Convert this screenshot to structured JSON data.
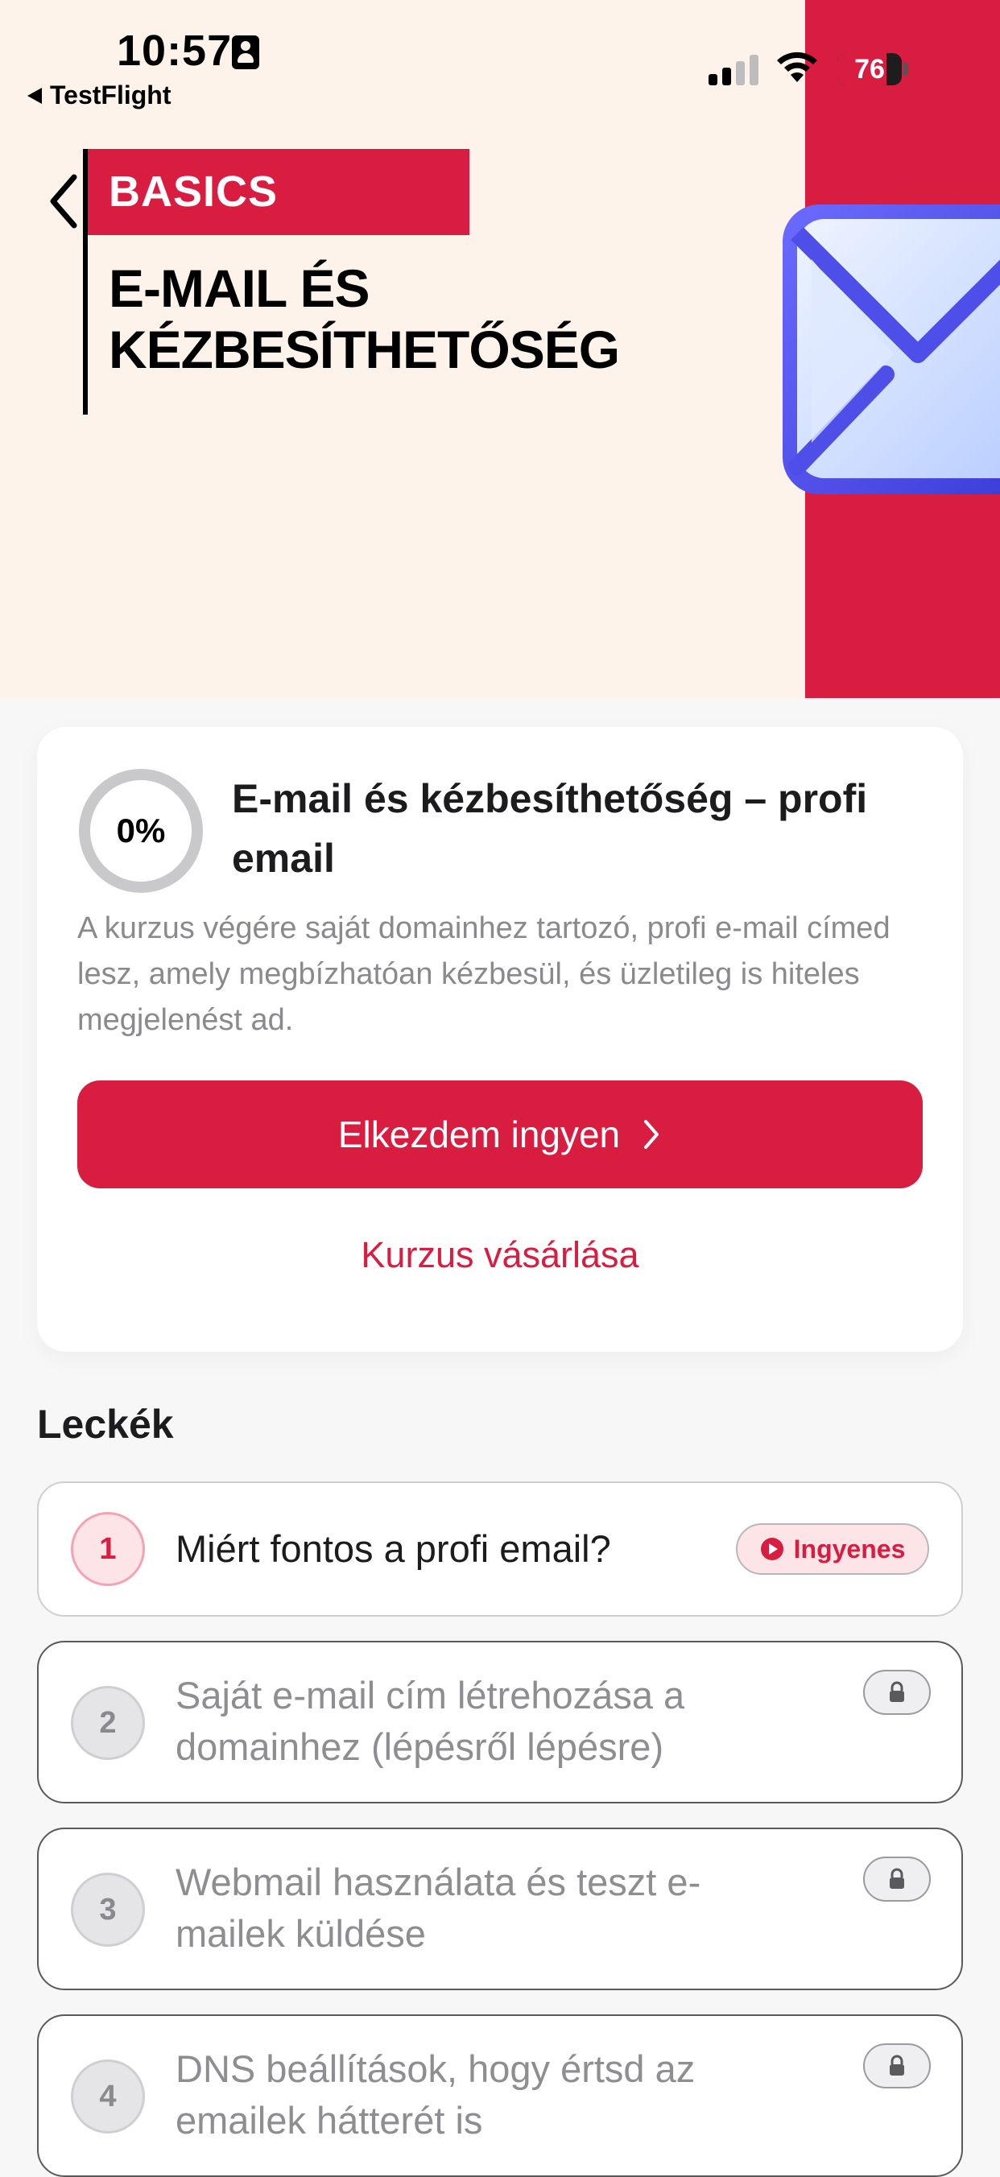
{
  "status_bar": {
    "time": "10:57",
    "back_app": "TestFlight",
    "battery": "76"
  },
  "hero": {
    "badge": "BASICS",
    "title_line1": "E-MAIL ÉS",
    "title_line2": "KÉZBESÍTHETŐSÉG"
  },
  "course": {
    "progress": "0%",
    "progress_value": 0,
    "title": "E-mail és kézbesíthetőség – profi email",
    "description": "A kurzus végére saját domainhez tartozó, profi e-mail címed lesz, amely megbízhatóan kézbesül, és üzletileg is hiteles megjelenést ad.",
    "start_label": "Elkezdem ingyen",
    "buy_label": "Kurzus vásárlása"
  },
  "lessons": {
    "heading": "Leckék",
    "items": [
      {
        "number": "1",
        "title": "Miért fontos a profi email?",
        "badge": "Ingyenes",
        "state": "free"
      },
      {
        "number": "2",
        "title": "Saját e-mail cím létrehozása a domainhez (lépésről lépésre)",
        "state": "locked"
      },
      {
        "number": "3",
        "title": "Webmail használata és teszt e-mailek küldése",
        "state": "locked"
      },
      {
        "number": "4",
        "title": "DNS beállítások, hogy értsd az emailek hátterét is",
        "state": "locked"
      }
    ]
  },
  "colors": {
    "accent": "#d81d41",
    "hero_bg": "#fdf3ea",
    "muted_text": "#8a8a8e"
  },
  "icons": [
    "person-card-icon",
    "signal-icon",
    "wifi-icon",
    "battery-icon",
    "back-chevron-icon",
    "envelope-icon",
    "chevron-right-icon",
    "play-icon",
    "lock-icon"
  ]
}
